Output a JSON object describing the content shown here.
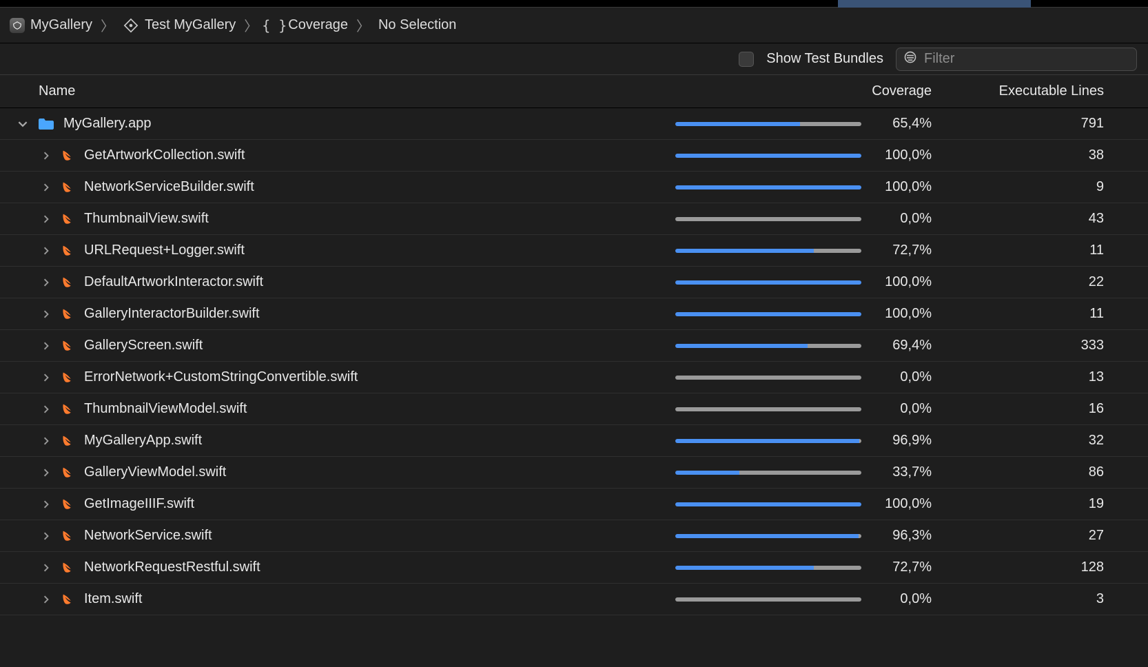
{
  "breadcrumb": {
    "project": "MyGallery",
    "scheme": "Test MyGallery",
    "section": "Coverage",
    "selection": "No Selection"
  },
  "toolbar": {
    "show_bundles_label": "Show Test Bundles",
    "filter_placeholder": "Filter"
  },
  "columns": {
    "name": "Name",
    "coverage": "Coverage",
    "lines": "Executable Lines"
  },
  "root": {
    "name": "MyGallery.app",
    "coverage_pct": "65,4%",
    "coverage_val": 65.4,
    "lines": "791"
  },
  "files": [
    {
      "name": "GetArtworkCollection.swift",
      "coverage_pct": "100,0%",
      "coverage_val": 100.0,
      "lines": "38"
    },
    {
      "name": "NetworkServiceBuilder.swift",
      "coverage_pct": "100,0%",
      "coverage_val": 100.0,
      "lines": "9"
    },
    {
      "name": "ThumbnailView.swift",
      "coverage_pct": "0,0%",
      "coverage_val": 0.0,
      "lines": "43"
    },
    {
      "name": "URLRequest+Logger.swift",
      "coverage_pct": "72,7%",
      "coverage_val": 72.7,
      "lines": "11"
    },
    {
      "name": "DefaultArtworkInteractor.swift",
      "coverage_pct": "100,0%",
      "coverage_val": 100.0,
      "lines": "22"
    },
    {
      "name": "GalleryInteractorBuilder.swift",
      "coverage_pct": "100,0%",
      "coverage_val": 100.0,
      "lines": "11"
    },
    {
      "name": "GalleryScreen.swift",
      "coverage_pct": "69,4%",
      "coverage_val": 69.4,
      "lines": "333"
    },
    {
      "name": "ErrorNetwork+CustomStringConvertible.swift",
      "coverage_pct": "0,0%",
      "coverage_val": 0.0,
      "lines": "13"
    },
    {
      "name": "ThumbnailViewModel.swift",
      "coverage_pct": "0,0%",
      "coverage_val": 0.0,
      "lines": "16"
    },
    {
      "name": "MyGalleryApp.swift",
      "coverage_pct": "96,9%",
      "coverage_val": 96.9,
      "lines": "32"
    },
    {
      "name": "GalleryViewModel.swift",
      "coverage_pct": "33,7%",
      "coverage_val": 33.7,
      "lines": "86"
    },
    {
      "name": "GetImageIIIF.swift",
      "coverage_pct": "100,0%",
      "coverage_val": 100.0,
      "lines": "19"
    },
    {
      "name": "NetworkService.swift",
      "coverage_pct": "96,3%",
      "coverage_val": 96.3,
      "lines": "27"
    },
    {
      "name": "NetworkRequestRestful.swift",
      "coverage_pct": "72,7%",
      "coverage_val": 72.7,
      "lines": "128"
    },
    {
      "name": "Item.swift",
      "coverage_pct": "0,0%",
      "coverage_val": 0.0,
      "lines": "3"
    }
  ]
}
